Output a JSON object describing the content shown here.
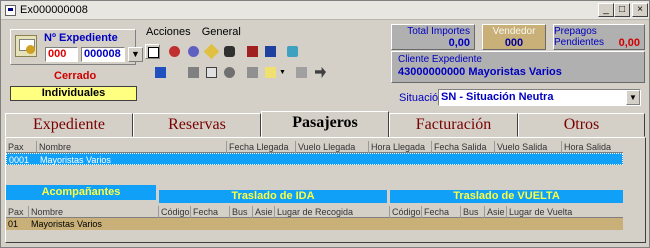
{
  "window": {
    "title": "Ex000000008",
    "min": "_",
    "max": "□",
    "close": "×"
  },
  "expediente": {
    "label": "Nº Expediente",
    "serie": "000",
    "numero": "000008",
    "button": "▼"
  },
  "status": {
    "state": "Cerrado",
    "type": "Individuales"
  },
  "menu": {
    "acciones": "Acciones",
    "general": "General"
  },
  "totals": {
    "total_label": "Total Importes",
    "total_value": "0,00",
    "vendedor_label": "Vendedor",
    "vendedor_value": "000",
    "prepagos_label": "Prepagos Pendientes",
    "prepagos_value": "0,00"
  },
  "cliente": {
    "label": "Cliente Expediente",
    "value": "43000000000 Mayoristas Varios"
  },
  "situacion": {
    "label": "Situación",
    "value": "SN - Situación Neutra",
    "arrow": "▼"
  },
  "tabs": [
    "Expediente",
    "Reservas",
    "Pasajeros",
    "Facturación",
    "Otros"
  ],
  "pasajeros": {
    "headers": [
      "Pax",
      "Nombre",
      "Fecha Llegada",
      "Vuelo Llegada",
      "Hora Llegada",
      "Fecha Salida",
      "Vuelo Salida",
      "Hora Salida"
    ],
    "rows": [
      {
        "pax": "0001",
        "nombre": "Mayoristas Varios"
      }
    ]
  },
  "acompanantes": {
    "title": "Acompañantes",
    "ida_title": "Traslado de IDA",
    "vuelta_title": "Traslado de VUELTA",
    "headers": [
      "Pax",
      "Nombre",
      "Código",
      "Fecha",
      "Bus",
      "Asie",
      "Lugar de Recogida",
      "Código",
      "Fecha",
      "Bus",
      "Asie",
      "Lugar de Vuelta"
    ],
    "rows": [
      {
        "pax": "01",
        "nombre": "Mayoristas Varios"
      }
    ]
  },
  "colors": {
    "accent_blue": "#10a0f8",
    "status_red": "#d00000",
    "highlight_yellow": "#ffff80",
    "row_gold": "#c8b078"
  }
}
